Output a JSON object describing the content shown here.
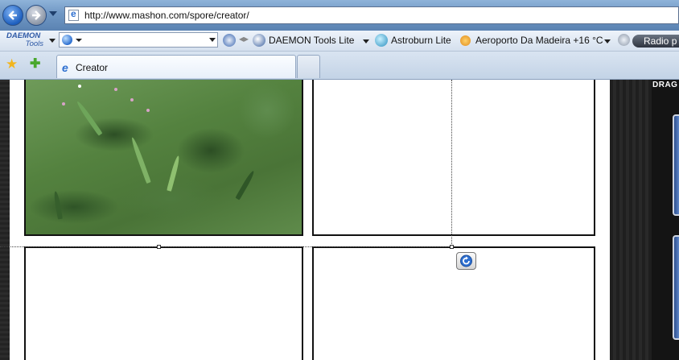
{
  "browser": {
    "address_url": "http://www.mashon.com/spore/creator/",
    "toolbar": {
      "daemon_logo_line1": "DAEMON",
      "daemon_logo_line2": "Tools",
      "items": [
        {
          "label": "DAEMON Tools Lite",
          "icon": "daemon-lightning-icon"
        },
        {
          "label": "Astroburn Lite",
          "icon": "astroburn-flame-icon"
        },
        {
          "label": "Aeroporto Da Madeira +16 °C",
          "icon": "weather-sun-icon"
        },
        {
          "label": "Radio p",
          "icon": "play-icon"
        }
      ]
    },
    "tab": {
      "title": "Creator"
    }
  },
  "page": {
    "drag_label": "DRAG"
  },
  "colors": {
    "chrome_blue": "#6f97c4",
    "panel_border": "#111111",
    "grass_green": "#54823f"
  }
}
